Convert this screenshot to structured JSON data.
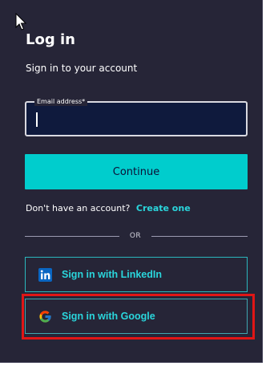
{
  "header": {
    "title": "Log in",
    "subtitle": "Sign in to your account"
  },
  "email": {
    "label": "Email address*",
    "value": ""
  },
  "actions": {
    "continue_label": "Continue"
  },
  "signup": {
    "prompt": "Don't have an account?",
    "link_label": "Create one"
  },
  "divider": {
    "text": "OR"
  },
  "social": {
    "linkedin_label": "Sign in with LinkedIn",
    "google_label": "Sign in with Google"
  },
  "colors": {
    "background": "#262537",
    "accent": "#00cdcd",
    "link": "#2ad6dc",
    "input_bg": "#0f1a3d",
    "highlight": "#e01616",
    "linkedin_blue": "#0a66c2"
  },
  "icons": {
    "cursor": "mouse-pointer-icon",
    "linkedin": "linkedin-icon",
    "google": "google-icon"
  }
}
